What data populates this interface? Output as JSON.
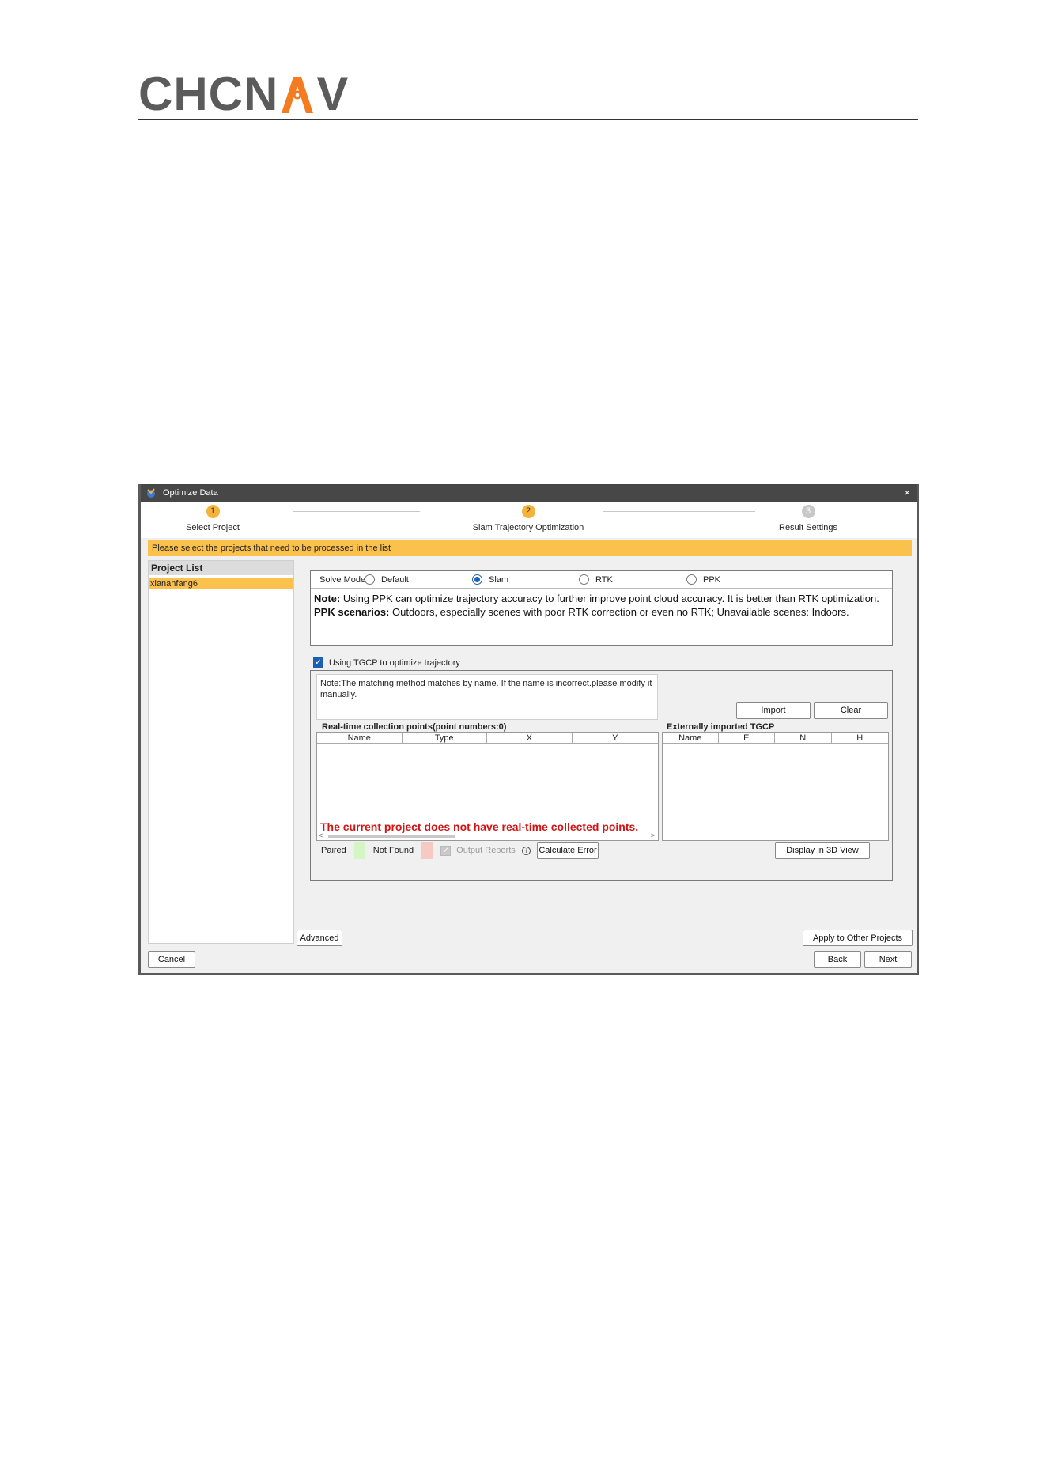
{
  "header": {
    "logo_text_left": "CHCN",
    "logo_text_right": "V"
  },
  "window": {
    "title": "Optimize Data",
    "close_glyph": "×",
    "steps": [
      {
        "number": "1",
        "label": "Select Project",
        "state": "active"
      },
      {
        "number": "2",
        "label": "Slam Trajectory Optimization",
        "state": "active"
      },
      {
        "number": "3",
        "label": "Result Settings",
        "state": "inactive"
      }
    ],
    "banner": "Please select the projects that need to be processed in the list",
    "project_list": {
      "header": "Project List",
      "items": [
        "xiananfang6"
      ]
    },
    "solve_mode": {
      "label": "Solve Mode",
      "options": [
        "Default",
        "Slam",
        "RTK",
        "PPK"
      ],
      "selected": "Slam"
    },
    "note": {
      "label": "Note:",
      "text": " Using PPK can optimize trajectory accuracy to further improve point cloud accuracy. It is better than RTK optimization.",
      "ppk_label": "PPK scenarios:",
      "ppk_text": " Outdoors, especially scenes with poor RTK correction or even no RTK; Unavailable scenes: Indoors."
    },
    "tgcp_checkbox": {
      "label": "Using TGCP to optimize trajectory",
      "checked": true
    },
    "match_note": "Note:The matching method matches by name. If the name is incorrect.please modify it manually.",
    "import_label": "Import",
    "clear_label": "Clear",
    "realtime": {
      "title": "Real-time collection points(point numbers:0)",
      "columns": [
        "Name",
        "Type",
        "X",
        "Y"
      ],
      "empty_message": "The current project does not have real-time collected points."
    },
    "external": {
      "title": "Externally imported TGCP",
      "columns": [
        "Name",
        "E",
        "N",
        "H"
      ]
    },
    "legend": {
      "paired_label": "Paired",
      "paired_color": "#d4f5c4",
      "not_found_label": "Not Found",
      "not_found_color": "#f6c9c4",
      "output_reports_label": "Output Reports",
      "info_glyph": "i"
    },
    "calculate_error_label": "Calculate Error",
    "display_3d_label": "Display in 3D View",
    "advanced_label": "Advanced",
    "apply_label": "Apply to Other Projects",
    "cancel_label": "Cancel",
    "back_label": "Back",
    "next_label": "Next"
  },
  "colors": {
    "accent": "#fbc14d",
    "step_active": "#f5b33a",
    "selected_radio": "#1a5fb4",
    "logo_gray": "#5b5b5b",
    "logo_orange": "#f47b20"
  }
}
